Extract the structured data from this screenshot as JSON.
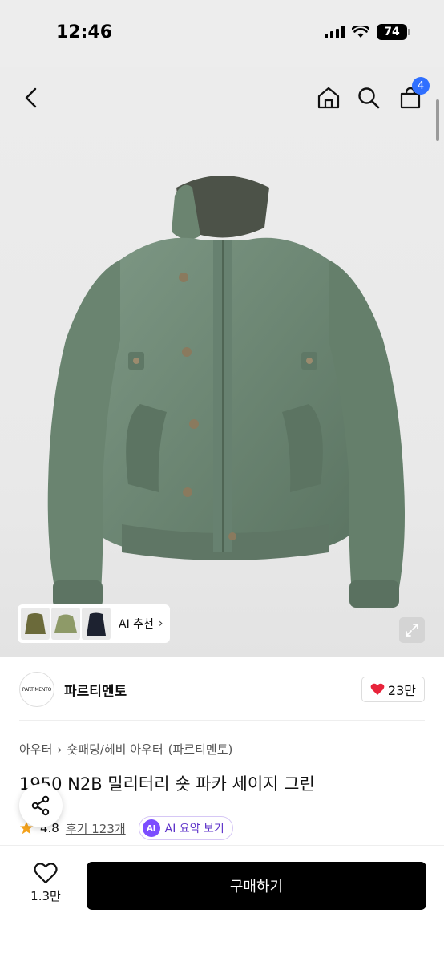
{
  "status_bar": {
    "time": "12:46",
    "battery": "74"
  },
  "nav": {
    "cart_count": "4"
  },
  "reco": {
    "label": "AI 추천",
    "chevron": "›"
  },
  "brand": {
    "logo_text": "PARTIMENTO",
    "name": "파르티멘토",
    "likes": "23만"
  },
  "breadcrumb": {
    "items": [
      "아우터",
      "숏패딩/헤비 아우터",
      "(파르티멘토)"
    ],
    "separator": "›"
  },
  "product": {
    "title": "1950 N2B 밀리터리 숏 파카 세이지 그린",
    "rating": "4.8",
    "reviews": "후기 123개",
    "ai_summary": "AI 요약 보기",
    "ai_badge": "AI"
  },
  "bottom": {
    "wish_count": "1.3만",
    "buy_label": "구매하기"
  },
  "colors": {
    "accent": "#2f6fff",
    "jacket": "#6f8a77",
    "heart": "#e8243b",
    "ai_purple": "#7c4dff"
  },
  "icons": [
    "back-icon",
    "home-icon",
    "search-icon",
    "cart-icon",
    "expand-icon",
    "heart-icon",
    "share-icon",
    "star-icon"
  ]
}
